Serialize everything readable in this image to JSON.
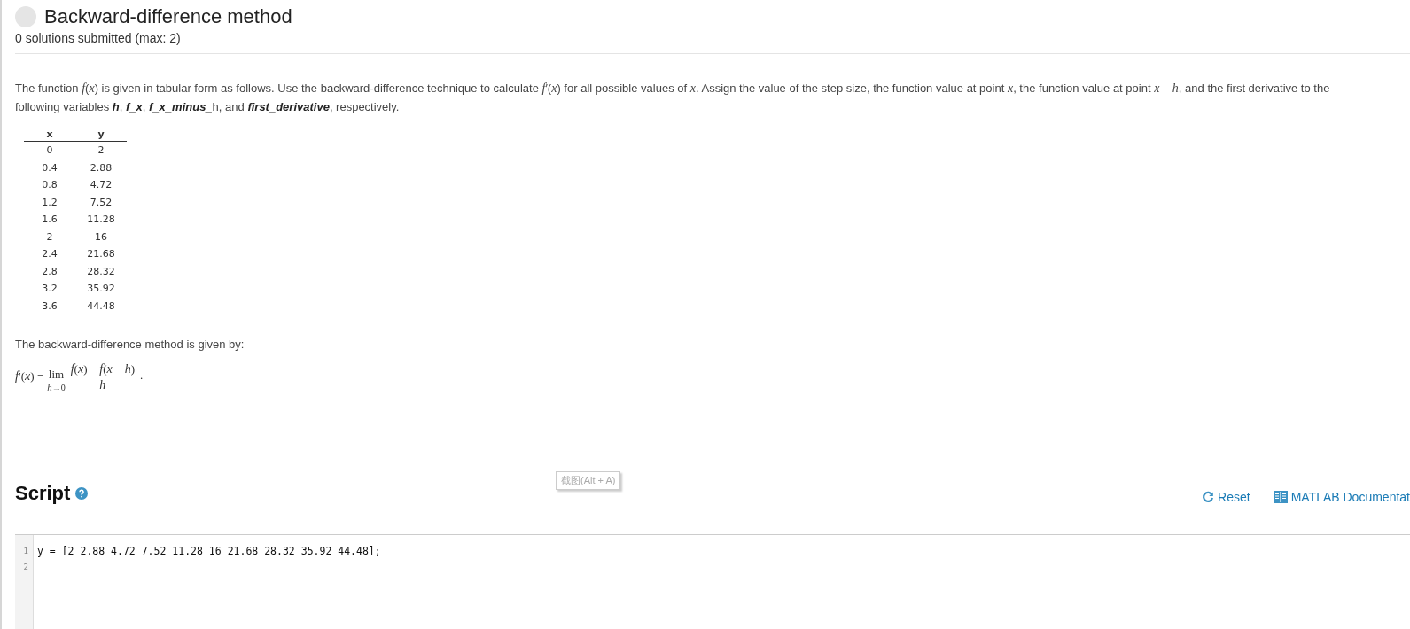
{
  "header": {
    "title": "Backward-difference method",
    "submissions": "0 solutions submitted (max: 2)"
  },
  "problem": {
    "text": "The function *f*(*x*) is given in tabular form as follows. Use the backward-difference technique to calculate *f*′(*x*) for all possible values of *x*. Assign the value of the step size, the function value at point *x*, the function value at point *x* – *h*, and the first derivative to the following variables **h**, **f_x**, **f_x_minus_**h, and **first_derivative**, respectively.",
    "table": {
      "columns": [
        "x",
        "y"
      ],
      "rows": [
        [
          "0",
          "2"
        ],
        [
          "0.4",
          "2.88"
        ],
        [
          "0.8",
          "4.72"
        ],
        [
          "1.2",
          "7.52"
        ],
        [
          "1.6",
          "11.28"
        ],
        [
          "2",
          "16"
        ],
        [
          "2.4",
          "21.68"
        ],
        [
          "2.8",
          "28.32"
        ],
        [
          "3.2",
          "35.92"
        ],
        [
          "3.6",
          "44.48"
        ]
      ]
    },
    "method_intro": "The backward-difference method is given by:",
    "formula": {
      "lhs": "*f*′(*x*) =",
      "operator": "lim",
      "limit": "*h*→0",
      "numerator": "*f*(*x*) − *f*(*x* − *h*)",
      "denominator": "*h*",
      "end": "."
    }
  },
  "script": {
    "heading": "Script",
    "tooltip": "截图(Alt + A)",
    "actions": [
      {
        "kind": "reset",
        "label": "Reset"
      },
      {
        "kind": "docs",
        "label": "MATLAB Documentat"
      }
    ],
    "lines": [
      {
        "number": "1",
        "code": "y = [2 2.88 4.72 7.52 11.28 16 21.68 28.32 35.92 44.48];"
      },
      {
        "number": "2"
      }
    ]
  }
}
